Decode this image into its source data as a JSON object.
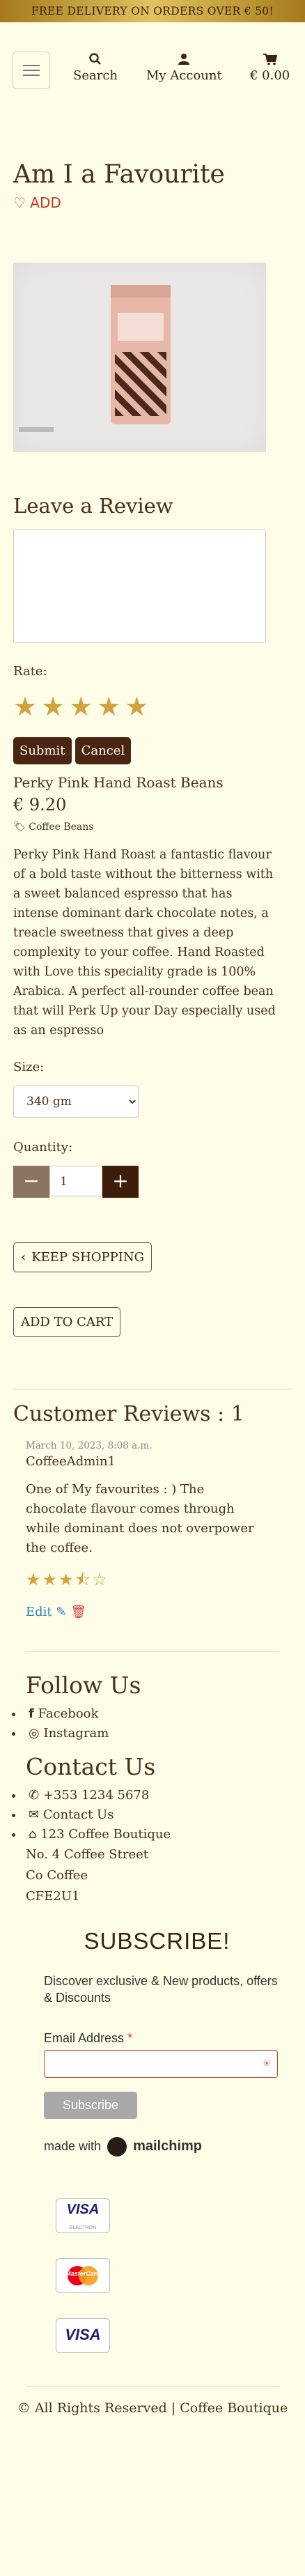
{
  "banner": {
    "text": "FREE DELIVERY ON ORDERS OVER € 50!"
  },
  "header": {
    "menu_icon": "hamburger-icon",
    "search_label": "Search",
    "account_label": "My Account",
    "cart_total": "€ 0.00"
  },
  "favourite": {
    "heading": "Am I a Favourite",
    "add_label": "ADD"
  },
  "review_form": {
    "heading": "Leave a Review",
    "rate_label": "Rate:",
    "stars": "★★★★★",
    "submit_label": "Submit",
    "cancel_label": "Cancel"
  },
  "product": {
    "name": "Perky Pink Hand Roast Beans",
    "price": "€ 9.20",
    "category": "Coffee Beans",
    "description": "Perky Pink Hand Roast a fantastic flavour of a bold taste without the bitterness with a sweet balanced espresso that has intense dominant dark chocolate notes, a treacle sweetness that gives a deep complexity to your coffee. Hand Roasted with Love this speciality grade is 100% Arabica. A perfect all-rounder coffee bean that will Perk Up your Day especially used as an espresso",
    "size_label": "Size:",
    "size_selected": "340 gm",
    "quantity_label": "Quantity:",
    "quantity_value": "1",
    "keep_shopping_label": "KEEP SHOPPING",
    "add_to_cart_label": "ADD TO CART"
  },
  "reviews": {
    "heading": "Customer Reviews : 1",
    "items": [
      {
        "date": "March 10, 2023, 8:08 a.m.",
        "author": "CoffeeAdmin1",
        "text": "One of My favourites : ) The chocolate flavour comes through while dominant does not overpower the coffee.",
        "rating": 3.5,
        "edit_label": "Edit"
      }
    ]
  },
  "follow": {
    "heading": "Follow Us",
    "links": [
      "Facebook",
      "Instagram"
    ]
  },
  "contact": {
    "heading": "Contact Us",
    "phone": "+353 1234 5678",
    "contact_link": "Contact Us",
    "address": [
      "123 Coffee Boutique",
      "No. 4 Coffee Street",
      "Co Coffee",
      "CFE2U1"
    ]
  },
  "mailchimp": {
    "heading": "SUBSCRIBE!",
    "subtext": "Discover exclusive & New products, offers & Discounts",
    "email_label": "Email Address",
    "required_mark": "*",
    "subscribe_label": "Subscribe",
    "made_with": "made with",
    "brand": "mailchimp"
  },
  "payment_cards": [
    {
      "brand": "VISA",
      "sub": "ELECTRON"
    },
    {
      "brand": "MasterCard",
      "sub": ""
    },
    {
      "brand": "VISA",
      "sub": ""
    }
  ],
  "copyright": "© All Rights Reserved | Coffee Boutique",
  "colors": {
    "background": "#fdfde8",
    "brand_dark": "#4a2512",
    "star": "#d0a33e",
    "banner_gold": "#e2c261",
    "edit_blue": "#2d7fc1",
    "delete_red": "#d9423b"
  }
}
